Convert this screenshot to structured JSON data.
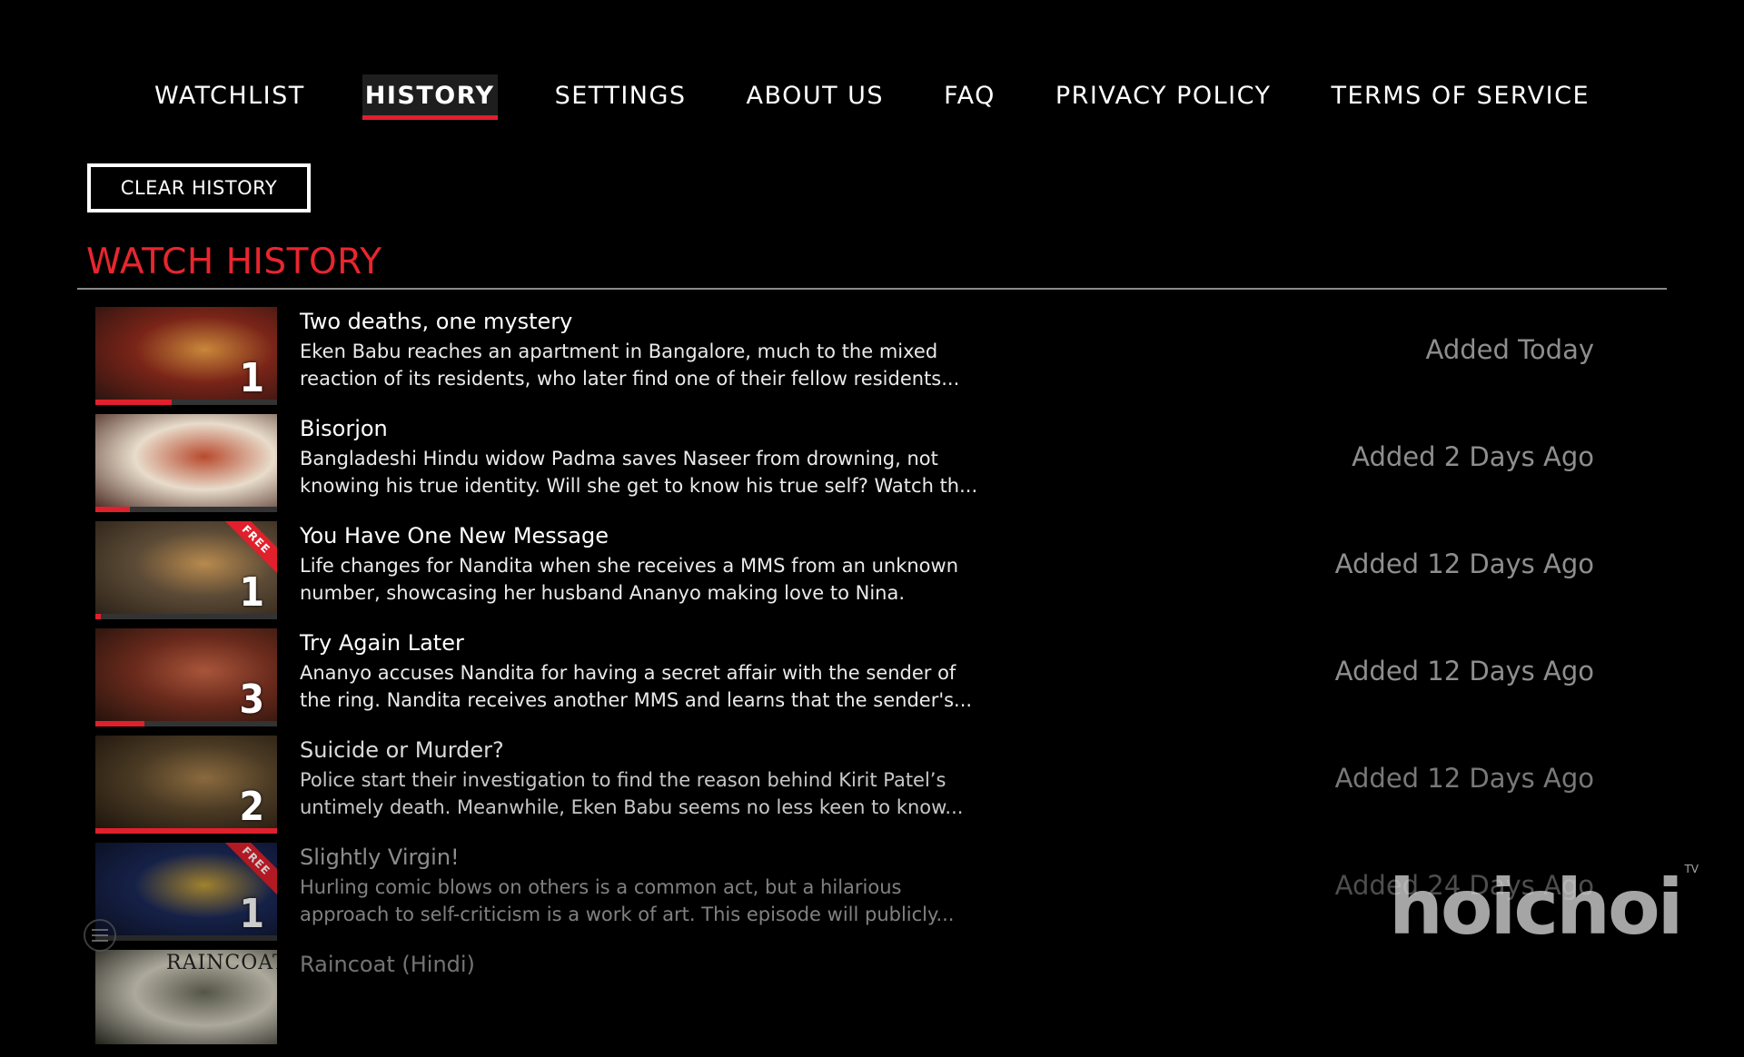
{
  "nav": {
    "items": [
      {
        "label": "WATCHLIST",
        "active": false
      },
      {
        "label": "HISTORY",
        "active": true
      },
      {
        "label": "SETTINGS",
        "active": false
      },
      {
        "label": "ABOUT US",
        "active": false
      },
      {
        "label": "FAQ",
        "active": false
      },
      {
        "label": "PRIVACY POLICY",
        "active": false
      },
      {
        "label": "TERMS OF SERVICE",
        "active": false
      }
    ]
  },
  "clear_button": {
    "label": "CLEAR HISTORY"
  },
  "section": {
    "title": "WATCH HISTORY"
  },
  "colors": {
    "accent": "#e0202c",
    "title_red": "#e8262f",
    "muted": "#8e8e8e"
  },
  "history": [
    {
      "title": "Two deaths, one mystery",
      "description": "Eken Babu reaches an apartment in Bangalore, much to the mixed reaction of its residents, who later find one of their fellow residents...",
      "added": "Added Today",
      "episode": "1",
      "free": false,
      "progress": 0.42,
      "thumb_colors": [
        "#7a2418",
        "#c9873a",
        "#2a1410"
      ]
    },
    {
      "title": "Bisorjon",
      "description": "Bangladeshi Hindu widow Padma saves Naseer from drowning, not knowing his true identity. Will she get to know his true self? Watch th...",
      "added": "Added 2 Days Ago",
      "episode": "",
      "free": false,
      "progress": 0.19,
      "thumb_colors": [
        "#e8dccb",
        "#b84a2e",
        "#4a2a22"
      ]
    },
    {
      "title": "You Have One New Message",
      "description": "Life changes for Nandita when she receives a MMS from an unknown number, showcasing her husband Ananyo making love to Nina.",
      "added": "Added 12 Days Ago",
      "episode": "1",
      "free": true,
      "progress": 0.03,
      "thumb_colors": [
        "#5b4a36",
        "#b88a4e",
        "#2c2218"
      ]
    },
    {
      "title": "Try Again Later",
      "description": "Ananyo accuses Nandita for having a secret affair with the sender of the ring. Nandita receives another MMS and learns that the sender's...",
      "added": "Added 12 Days Ago",
      "episode": "3",
      "free": false,
      "progress": 0.27,
      "thumb_colors": [
        "#6a2a1c",
        "#a8553a",
        "#24120c"
      ]
    },
    {
      "title": "Suicide or Murder?",
      "description": "Police start their investigation to find the reason behind Kirit Patel’s untimely death. Meanwhile, Eken Babu seems no less keen to know...",
      "added": "Added 12 Days Ago",
      "episode": "2",
      "free": false,
      "progress": 1.0,
      "thumb_colors": [
        "#4a3a24",
        "#8a6a3e",
        "#1c140c"
      ]
    },
    {
      "title": "Slightly Virgin!",
      "description": "Hurling comic blows on others is a common act, but a hilarious approach to self-criticism is a work of art. This episode will publicly...",
      "added": "Added 24 Days Ago",
      "episode": "1",
      "free": true,
      "progress": 0.0,
      "thumb_colors": [
        "#1c2a5a",
        "#c9a23a",
        "#0c1228"
      ]
    },
    {
      "title": "Raincoat (Hindi)",
      "description": "",
      "added": "",
      "episode": "",
      "free": false,
      "progress": 0.0,
      "thumb_text": "RAINCOAT",
      "thumb_colors": [
        "#d8d4c4",
        "#6a6a5a",
        "#2a2a22"
      ]
    }
  ],
  "logo": {
    "text": "hoichoi",
    "suffix": "TV"
  },
  "menu_icon": "hamburger-menu-icon"
}
